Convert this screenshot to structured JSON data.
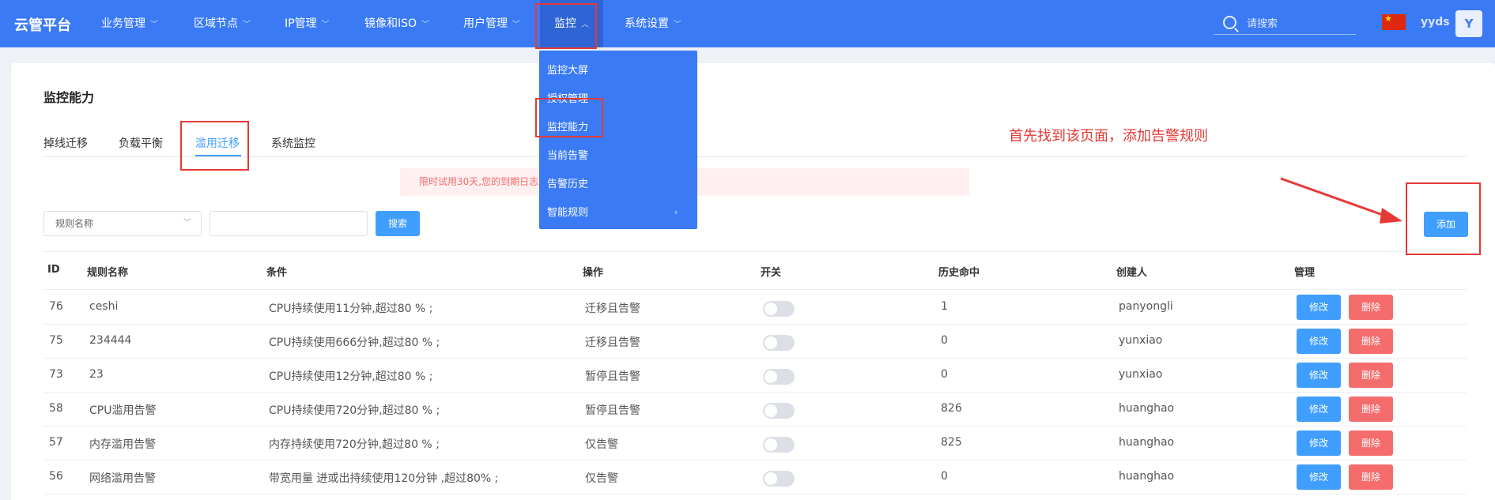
{
  "app": {
    "title": "云管平台"
  },
  "nav": [
    {
      "label": "业务管理"
    },
    {
      "label": "区域节点"
    },
    {
      "label": "IP管理"
    },
    {
      "label": "镜像和ISO"
    },
    {
      "label": "用户管理"
    },
    {
      "label": "监控"
    },
    {
      "label": "系统设置"
    }
  ],
  "search": {
    "placeholder": "请搜索"
  },
  "user": {
    "name": "yyds",
    "avatar": "Y"
  },
  "dropdown": [
    {
      "label": "监控大屏"
    },
    {
      "label": "授权管理"
    },
    {
      "label": "监控能力"
    },
    {
      "label": "当前告警"
    },
    {
      "label": "告警历史"
    },
    {
      "label": "智能规则"
    }
  ],
  "page": {
    "title": "监控能力"
  },
  "tabs": [
    {
      "label": "掉线迁移"
    },
    {
      "label": "负载平衡"
    },
    {
      "label": "滥用迁移"
    },
    {
      "label": "系统监控"
    }
  ],
  "notice": "限时试用30天,您的到期日志                      功能将会关闭,请前往应用商店订购",
  "filter": {
    "select_label": "规则名称",
    "search_button": "搜索",
    "add_button": "添加"
  },
  "annotation": "首先找到该页面，添加告警规则",
  "table": {
    "headers": [
      "ID",
      "规则名称",
      "条件",
      "操作",
      "开关",
      "历史命中",
      "创建人",
      "管理"
    ],
    "rows": [
      {
        "id": "76",
        "name": "ceshi",
        "condition": "CPU持续使用11分钟,超过80 % ;",
        "action": "迁移且告警",
        "hits": "1",
        "creator": "panyongli"
      },
      {
        "id": "75",
        "name": "234444",
        "condition": "CPU持续使用666分钟,超过80 % ;",
        "action": "迁移且告警",
        "hits": "0",
        "creator": "yunxiao"
      },
      {
        "id": "73",
        "name": "23",
        "condition": "CPU持续使用12分钟,超过80 % ;",
        "action": "暂停且告警",
        "hits": "0",
        "creator": "yunxiao"
      },
      {
        "id": "58",
        "name": "CPU滥用告警",
        "condition": "CPU持续使用720分钟,超过80 % ;",
        "action": "暂停且告警",
        "hits": "826",
        "creator": "huanghao"
      },
      {
        "id": "57",
        "name": "内存滥用告警",
        "condition": "内存持续使用720分钟,超过80 % ;",
        "action": "仅告警",
        "hits": "825",
        "creator": "huanghao"
      },
      {
        "id": "56",
        "name": "网络滥用告警",
        "condition": "带宽用量 进或出持续使用120分钟 ,超过80% ;",
        "action": "仅告警",
        "hits": "0",
        "creator": "huanghao"
      }
    ],
    "edit_label": "修改",
    "delete_label": "删除"
  },
  "colors": {
    "primary": "#3a7af5",
    "accent": "#409eff",
    "danger": "#f56c6c",
    "annotation": "#e53935"
  }
}
